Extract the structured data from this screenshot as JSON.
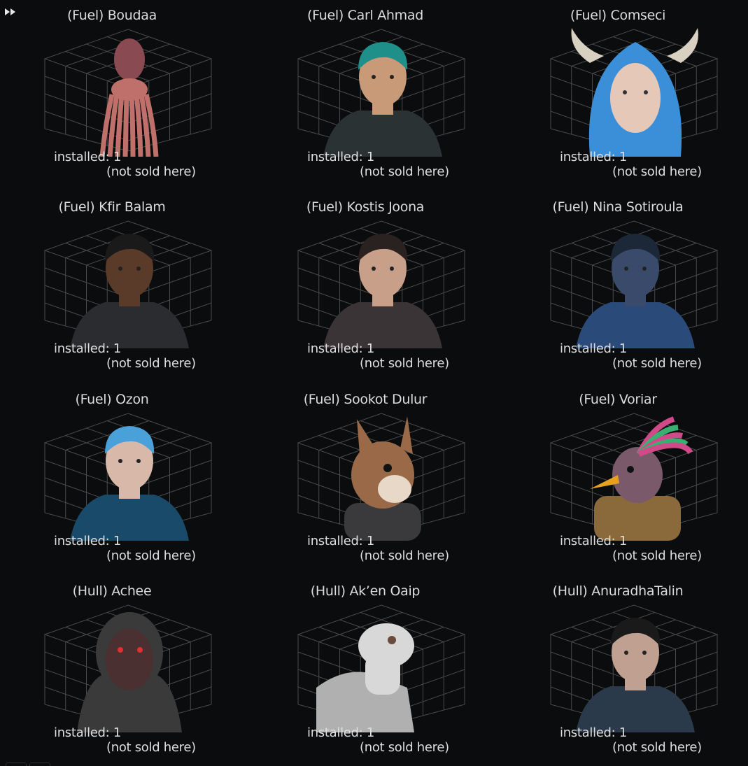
{
  "toolbar": {
    "icon": "fast-forward-icon"
  },
  "labels": {
    "installed_prefix": "installed:",
    "not_sold": "(not sold here)"
  },
  "colors": {
    "background": "#0b0c0d",
    "text": "#dedede",
    "grid_lines": "#4a4a4a"
  },
  "officers": [
    {
      "title": "(Fuel) Boudaa",
      "installed": "installed: 1",
      "availability": "(not sold here)",
      "portrait": "squid",
      "colors": [
        "#c0706a",
        "#8a4a52"
      ]
    },
    {
      "title": "(Fuel) Carl Ahmad",
      "installed": "installed: 1",
      "availability": "(not sold here)",
      "portrait": "human",
      "colors": [
        "#1f8f8a",
        "#c89a78",
        "#2b3234"
      ]
    },
    {
      "title": "(Fuel) Comseci",
      "installed": "installed: 1",
      "availability": "(not sold here)",
      "portrait": "horned-alien",
      "colors": [
        "#3b8fd8",
        "#e6c8b8",
        "#d8d0c0"
      ]
    },
    {
      "title": "(Fuel) Kfir Balam",
      "installed": "installed: 1",
      "availability": "(not sold here)",
      "portrait": "human",
      "colors": [
        "#1a1a1a",
        "#5a3a28",
        "#2a2c30"
      ]
    },
    {
      "title": "(Fuel) Kostis Joona",
      "installed": "installed: 1",
      "availability": "(not sold here)",
      "portrait": "human",
      "colors": [
        "#2a2220",
        "#c8a08a",
        "#3a3436"
      ]
    },
    {
      "title": "(Fuel) Nina Sotiroula",
      "installed": "installed: 1",
      "availability": "(not sold here)",
      "portrait": "human",
      "colors": [
        "#1c2838",
        "#3a4a6a",
        "#2a4a7a"
      ]
    },
    {
      "title": "(Fuel) Ozon",
      "installed": "installed: 1",
      "availability": "(not sold here)",
      "portrait": "human",
      "colors": [
        "#4aa0d8",
        "#d8b8a8",
        "#1a4a6a"
      ]
    },
    {
      "title": "(Fuel) Sookot Dulur",
      "installed": "installed: 1",
      "availability": "(not sold here)",
      "portrait": "squirrel",
      "colors": [
        "#9a6a48",
        "#e8d8c8",
        "#3a3a3c"
      ]
    },
    {
      "title": "(Fuel) Voriar",
      "installed": "installed: 1",
      "availability": "(not sold here)",
      "portrait": "bird",
      "colors": [
        "#d04a8a",
        "#e8a020",
        "#8a6a3a"
      ]
    },
    {
      "title": "(Hull) Achee",
      "installed": "installed: 1",
      "availability": "(not sold here)",
      "portrait": "hooded-alien",
      "colors": [
        "#3a3a3a",
        "#4a3030",
        "#e03030"
      ]
    },
    {
      "title": "(Hull) Ak’en Oaip",
      "installed": "installed: 1",
      "availability": "(not sold here)",
      "portrait": "lizard",
      "colors": [
        "#b0b0b0",
        "#d8d8d8",
        "#c8c8c8"
      ]
    },
    {
      "title": "(Hull) AnuradhaTalin",
      "installed": "installed: 1",
      "availability": "(not sold here)",
      "portrait": "human",
      "colors": [
        "#1a1a1a",
        "#c0a090",
        "#2a3a4a"
      ]
    }
  ]
}
